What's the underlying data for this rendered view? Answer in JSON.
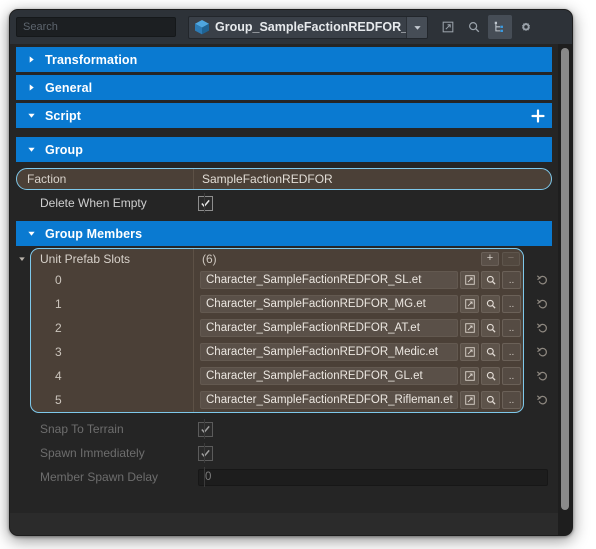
{
  "topbar": {
    "search_placeholder": "Search",
    "search_value": "",
    "entity_title": "Group_SampleFactionREDFOR_Rifl",
    "cube_icon": "prefab-cube-icon",
    "dropdown_icon": "chevron-down-icon",
    "buttons": [
      {
        "name": "open-external-button",
        "icon": "external-link-icon",
        "active": false
      },
      {
        "name": "find-button",
        "icon": "magnifier-icon",
        "active": false
      },
      {
        "name": "hierarchy-button",
        "icon": "hierarchy-tree-icon",
        "active": true
      },
      {
        "name": "settings-button",
        "icon": "gear-icon",
        "active": false
      }
    ]
  },
  "sections": {
    "transformation": {
      "title": "Transformation",
      "expanded": false,
      "chevron": "chevron-right-icon"
    },
    "general": {
      "title": "General",
      "expanded": false,
      "chevron": "chevron-right-icon"
    },
    "script": {
      "title": "Script",
      "expanded": true,
      "chevron": "chevron-down-icon",
      "add_icon": "plus-icon"
    },
    "group": {
      "title": "Group",
      "expanded": true,
      "chevron": "chevron-down-icon"
    },
    "group_members": {
      "title": "Group Members",
      "expanded": true,
      "chevron": "chevron-down-icon"
    }
  },
  "group": {
    "faction": {
      "label": "Faction",
      "value": "SampleFactionREDFOR",
      "selected": true
    },
    "delete_when_empty": {
      "label": "Delete When Empty",
      "checked": true
    }
  },
  "group_members": {
    "array": {
      "label": "Unit Prefab Slots",
      "count": "(6)",
      "add_label": "+",
      "remove_label": "..",
      "remove_symbol": "−",
      "collapse_icon": "triangle-down-icon",
      "rows": [
        {
          "index": "0",
          "value": "Character_SampleFactionREDFOR_SL.et"
        },
        {
          "index": "1",
          "value": "Character_SampleFactionREDFOR_MG.et"
        },
        {
          "index": "2",
          "value": "Character_SampleFactionREDFOR_AT.et"
        },
        {
          "index": "3",
          "value": "Character_SampleFactionREDFOR_Medic.et"
        },
        {
          "index": "4",
          "value": "Character_SampleFactionREDFOR_GL.et"
        },
        {
          "index": "5",
          "value": "Character_SampleFactionREDFOR_Rifleman.et"
        }
      ],
      "row_buttons": [
        {
          "name": "open-resource-button",
          "icon": "external-link-icon"
        },
        {
          "name": "locate-resource-button",
          "icon": "magnifier-icon"
        },
        {
          "name": "more-options-button",
          "icon": "ellipsis-icon",
          "label": ".."
        }
      ],
      "revert_icon": "revert-arrow-icon"
    },
    "snap_to_terrain": {
      "label": "Snap To Terrain",
      "checked": true,
      "disabled": true
    },
    "spawn_immediately": {
      "label": "Spawn Immediately",
      "checked": true,
      "disabled": true
    },
    "member_spawn_delay": {
      "label": "Member Spawn Delay",
      "value": "0",
      "disabled": true
    }
  },
  "colors": {
    "accent_blue": "#0a7ad1",
    "selection_border": "#7ec8ea",
    "selection_fill": "#4b4037",
    "panel_bg": "#252525",
    "topbar_bg": "#2d3238"
  },
  "scrollbar": {
    "name": "vertical-scrollbar"
  }
}
